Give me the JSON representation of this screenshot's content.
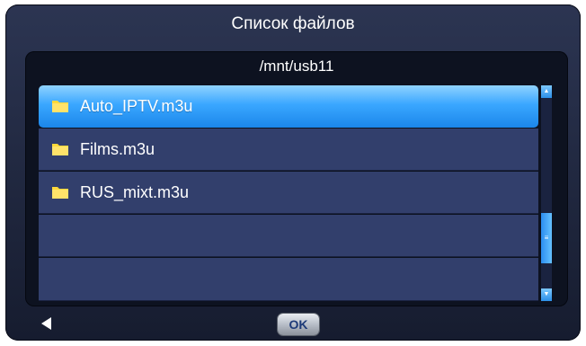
{
  "dialog": {
    "title": "Список файлов",
    "path": "/mnt/usb11"
  },
  "files": [
    {
      "name": "Auto_IPTV.m3u",
      "icon": "folder-icon",
      "selected": true
    },
    {
      "name": "Films.m3u",
      "icon": "folder-icon",
      "selected": false
    },
    {
      "name": "RUS_mixt.m3u",
      "icon": "folder-icon",
      "selected": false
    },
    {
      "name": "",
      "icon": "",
      "selected": false
    },
    {
      "name": "",
      "icon": "",
      "selected": false
    }
  ],
  "scrollbar": {
    "up_icon": "scroll-up-icon",
    "down_icon": "scroll-down-icon",
    "thumb_glyph": "≡"
  },
  "footer": {
    "back_icon": "back-arrow-icon",
    "ok_label": "OK"
  },
  "colors": {
    "selection": "#3aa7ff",
    "row": "#323f6c",
    "folder": "#ffd83a"
  }
}
